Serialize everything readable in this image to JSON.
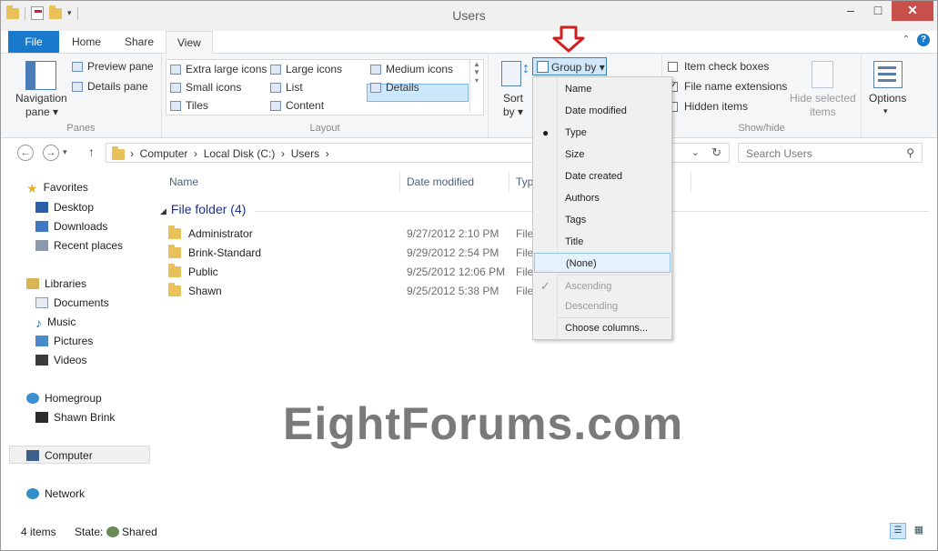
{
  "window": {
    "title": "Users"
  },
  "tabs": [
    {
      "label": "File"
    },
    {
      "label": "Home"
    },
    {
      "label": "Share"
    },
    {
      "label": "View"
    }
  ],
  "ribbon": {
    "panes": {
      "navigation_pane_line1": "Navigation",
      "navigation_pane_line2": "pane",
      "preview_pane": "Preview pane",
      "details_pane": "Details pane",
      "label": "Panes"
    },
    "layout": {
      "items": [
        "Extra large icons",
        "Large icons",
        "Medium icons",
        "Small icons",
        "List",
        "Details",
        "Tiles",
        "Content"
      ],
      "selected": "Details",
      "label": "Layout"
    },
    "current_view": {
      "sort_line1": "Sort",
      "sort_line2": "by",
      "group_by": "Group by"
    },
    "show_hide": {
      "item_check_boxes": "Item check boxes",
      "file_name_extensions": "File name extensions",
      "hidden_items": "Hidden items",
      "hide_selected_line1": "Hide selected",
      "hide_selected_line2": "items",
      "label": "Show/hide",
      "item_check_boxes_checked": false,
      "file_name_extensions_checked": true,
      "hidden_items_checked": false
    },
    "options": "Options"
  },
  "address": {
    "path": [
      "Computer",
      "Local Disk (C:)",
      "Users"
    ],
    "search_placeholder": "Search Users"
  },
  "nav": {
    "favorites": "Favorites",
    "desktop": "Desktop",
    "downloads": "Downloads",
    "recent_places": "Recent places",
    "libraries": "Libraries",
    "documents": "Documents",
    "music": "Music",
    "pictures": "Pictures",
    "videos": "Videos",
    "homegroup": "Homegroup",
    "shawn_brink": "Shawn Brink",
    "computer": "Computer",
    "network": "Network"
  },
  "columns": {
    "name": "Name",
    "date_modified": "Date modified",
    "type": "Typ"
  },
  "group_header": "File folder (4)",
  "files": [
    {
      "name": "Administrator",
      "date": "9/27/2012 2:10 PM",
      "type": "File"
    },
    {
      "name": "Brink-Standard",
      "date": "9/29/2012 2:54 PM",
      "type": "File"
    },
    {
      "name": "Public",
      "date": "9/25/2012 12:06 PM",
      "type": "File"
    },
    {
      "name": "Shawn",
      "date": "9/25/2012 5:38 PM",
      "type": "File"
    }
  ],
  "menu": {
    "name": "Name",
    "date_modified": "Date modified",
    "type": "Type",
    "size": "Size",
    "date_created": "Date created",
    "authors": "Authors",
    "tags": "Tags",
    "title": "Title",
    "none": "(None)",
    "ascending": "Ascending",
    "descending": "Descending",
    "choose_columns": "Choose columns..."
  },
  "status": {
    "items": "4 items",
    "state_label": "State:",
    "state_value": "Shared"
  },
  "watermark": "EightForums.com",
  "colors": {
    "accent": "#1979ca",
    "arrow": "#d21e1e",
    "selection": "#cde8fb"
  }
}
